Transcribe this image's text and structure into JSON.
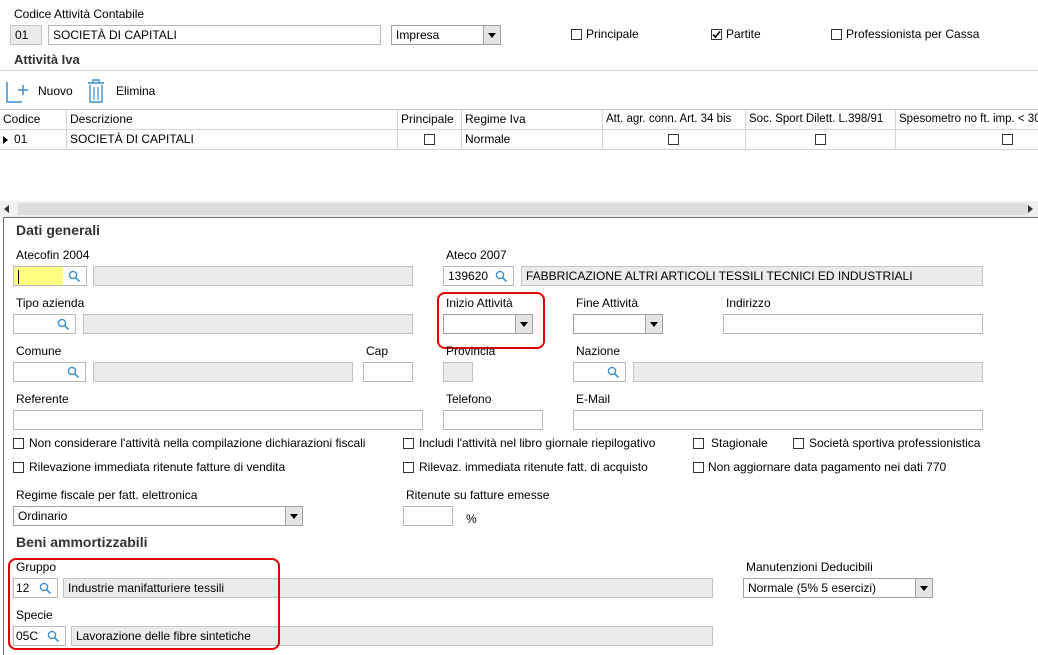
{
  "header": {
    "codice_attivita_label": "Codice Attività Contabile",
    "code": "01",
    "description": "SOCIETÀ DI CAPITALI",
    "type_select": "Impresa",
    "principale_label": "Principale",
    "partite_label": "Partite",
    "professionista_label": "Professionista per Cassa"
  },
  "attivita_iva": {
    "title": "Attività Iva",
    "new_label": "Nuovo",
    "delete_label": "Elimina"
  },
  "grid": {
    "columns": [
      "Codice",
      "Descrizione",
      "Principale",
      "Regime Iva",
      "Att. agr. conn. Art. 34 bis",
      "Soc. Sport Dilett. L.398/91",
      "Spesometro no ft. imp. < 30"
    ],
    "row": {
      "codice": "01",
      "descrizione": "SOCIETÀ DI CAPITALI",
      "regime": "Normale"
    }
  },
  "dati_generali": {
    "title": "Dati generali",
    "atecofin_label": "Atecofin 2004",
    "ateco_label": "Ateco 2007",
    "ateco_code": "139620",
    "ateco_desc": "FABBRICAZIONE ALTRI ARTICOLI TESSILI TECNICI ED INDUSTRIALI",
    "tipo_azienda_label": "Tipo azienda",
    "inizio_label": "Inizio Attività",
    "fine_label": "Fine Attività",
    "indirizzo_label": "Indirizzo",
    "comune_label": "Comune",
    "cap_label": "Cap",
    "provincia_label": "Provincia",
    "nazione_label": "Nazione",
    "referente_label": "Referente",
    "telefono_label": "Telefono",
    "email_label": "E-Mail",
    "chk1": "Non considerare l'attività nella compilazione dichiarazioni fiscali",
    "chk2": "Includi l'attività nel libro giornale riepilogativo",
    "chk3": "Stagionale",
    "chk4": "Società sportiva professionistica",
    "chk5": "Rilevazione immediata ritenute fatture di vendita",
    "chk6": "Rilevaz. immediata ritenute fatt. di acquisto",
    "chk7": "Non aggiornare data pagamento nei dati 770",
    "regime_fiscale_label": "Regime fiscale per fatt. elettronica",
    "regime_fiscale_value": "Ordinario",
    "ritenute_label": "Ritenute su fatture emesse",
    "percent": "%"
  },
  "beni": {
    "title": "Beni ammortizzabili",
    "gruppo_label": "Gruppo",
    "gruppo_code": "12",
    "gruppo_desc": "Industrie manifatturiere tessili",
    "specie_label": "Specie",
    "specie_code": "05C",
    "specie_desc": "Lavorazione delle fibre sintetiche",
    "manutenzioni_label": "Manutenzioni Deducibili",
    "manutenzioni_value": "Normale (5% 5 esercizi)"
  },
  "colors": {
    "highlight": "#e00000",
    "readonly": "#ebebeb",
    "focus": "#ffff80",
    "icon_blue": "#3a8fd0"
  }
}
